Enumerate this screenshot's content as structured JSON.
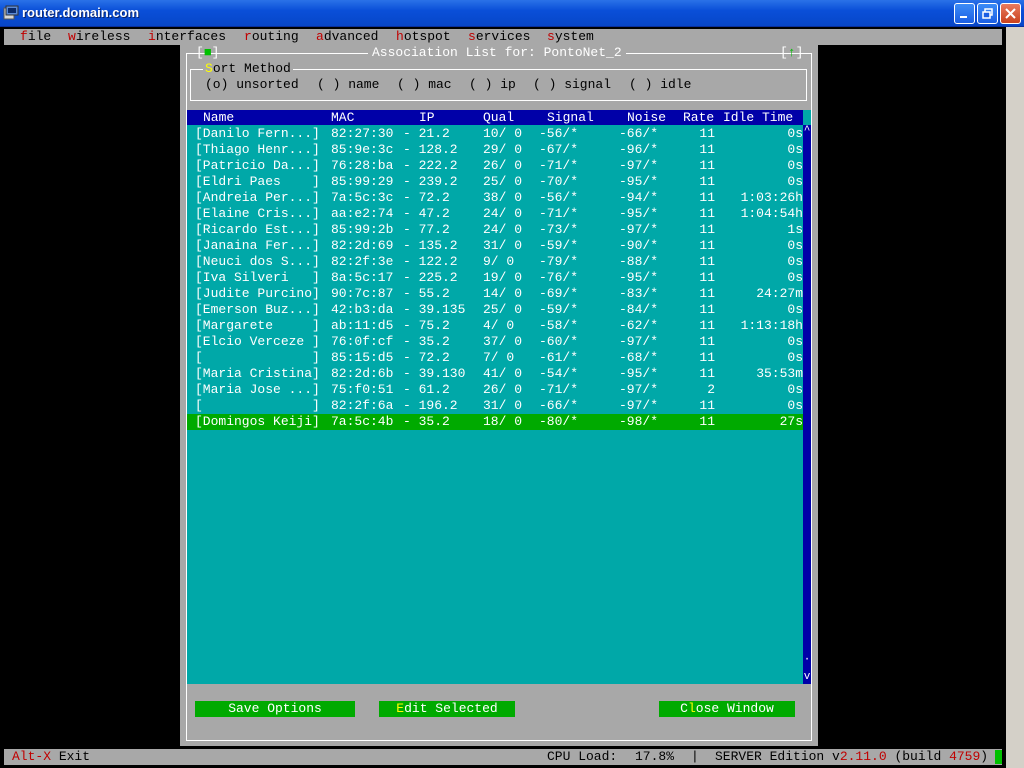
{
  "window": {
    "title": "router.domain.com"
  },
  "menu": [
    {
      "hot": "f",
      "rest": "ile"
    },
    {
      "hot": "w",
      "rest": "ireless"
    },
    {
      "hot": "i",
      "rest": "nterfaces"
    },
    {
      "hot": "r",
      "rest": "outing"
    },
    {
      "hot": "a",
      "rest": "dvanced"
    },
    {
      "hot": "h",
      "rest": "otspot"
    },
    {
      "hot": "s",
      "rest": "ervices"
    },
    {
      "hot": "s",
      "rest": "ystem"
    }
  ],
  "dialog": {
    "title": "Association List for: PontoNet_2",
    "left_corner": "[",
    "left_corner_mark": "■",
    "left_corner_end": "]",
    "right_corner": "[",
    "right_corner_mark": "↑",
    "right_corner_end": "]"
  },
  "sort": {
    "legend_hot": "S",
    "legend_rest": "ort Method",
    "options": [
      "(o) unsorted",
      "( ) name",
      "( ) mac",
      "( ) ip",
      "( ) signal",
      "( ) idle"
    ]
  },
  "columns": {
    "name": "Name",
    "mac": "MAC",
    "ip": "IP",
    "qual": "Qual",
    "signal": "Signal",
    "noise": "Noise",
    "rate": "Rate",
    "idle": "Idle Time"
  },
  "rows": [
    {
      "name": "[Danilo Fern...]",
      "mac": "82:27:30",
      "ip": "- 21.2",
      "qual": "10/ 0",
      "signal": "-56/*",
      "noise": "-66/*",
      "rate": "11",
      "idle": "0s"
    },
    {
      "name": "[Thiago Henr...]",
      "mac": "85:9e:3c",
      "ip": "- 128.2",
      "qual": "29/ 0",
      "signal": "-67/*",
      "noise": "-96/*",
      "rate": "11",
      "idle": "0s"
    },
    {
      "name": "[Patricio Da...]",
      "mac": "76:28:ba",
      "ip": "- 222.2",
      "qual": "26/ 0",
      "signal": "-71/*",
      "noise": "-97/*",
      "rate": "11",
      "idle": "0s"
    },
    {
      "name": "[Eldri Paes    ]",
      "mac": "85:99:29",
      "ip": "- 239.2",
      "qual": "25/ 0",
      "signal": "-70/*",
      "noise": "-95/*",
      "rate": "11",
      "idle": "0s"
    },
    {
      "name": "[Andreia Per...]",
      "mac": "7a:5c:3c",
      "ip": "- 72.2",
      "qual": "38/ 0",
      "signal": "-56/*",
      "noise": "-94/*",
      "rate": "11",
      "idle": "1:03:26h"
    },
    {
      "name": "[Elaine Cris...]",
      "mac": "aa:e2:74",
      "ip": "- 47.2",
      "qual": "24/ 0",
      "signal": "-71/*",
      "noise": "-95/*",
      "rate": "11",
      "idle": "1:04:54h"
    },
    {
      "name": "[Ricardo Est...]",
      "mac": "85:99:2b",
      "ip": "- 77.2",
      "qual": "24/ 0",
      "signal": "-73/*",
      "noise": "-97/*",
      "rate": "11",
      "idle": "1s"
    },
    {
      "name": "[Janaina Fer...]",
      "mac": "82:2d:69",
      "ip": "- 135.2",
      "qual": "31/ 0",
      "signal": "-59/*",
      "noise": "-90/*",
      "rate": "11",
      "idle": "0s"
    },
    {
      "name": "[Neuci dos S...]",
      "mac": "82:2f:3e",
      "ip": "- 122.2",
      "qual": "9/ 0",
      "signal": "-79/*",
      "noise": "-88/*",
      "rate": "11",
      "idle": "0s"
    },
    {
      "name": "[Iva Silveri   ]",
      "mac": "8a:5c:17",
      "ip": "- 225.2",
      "qual": "19/ 0",
      "signal": "-76/*",
      "noise": "-95/*",
      "rate": "11",
      "idle": "0s"
    },
    {
      "name": "[Judite Purcino]",
      "mac": "90:7c:87",
      "ip": "- 55.2",
      "qual": "14/ 0",
      "signal": "-69/*",
      "noise": "-83/*",
      "rate": "11",
      "idle": "24:27m"
    },
    {
      "name": "[Emerson Buz...]",
      "mac": "42:b3:da",
      "ip": "- 39.135",
      "qual": "25/ 0",
      "signal": "-59/*",
      "noise": "-84/*",
      "rate": "11",
      "idle": "0s"
    },
    {
      "name": "[Margarete     ]",
      "mac": "ab:11:d5",
      "ip": "- 75.2",
      "qual": "4/ 0",
      "signal": "-58/*",
      "noise": "-62/*",
      "rate": "11",
      "idle": "1:13:18h"
    },
    {
      "name": "[Elcio Verceze ]",
      "mac": "76:0f:cf",
      "ip": "- 35.2",
      "qual": "37/ 0",
      "signal": "-60/*",
      "noise": "-97/*",
      "rate": "11",
      "idle": "0s"
    },
    {
      "name": "[              ]",
      "mac": "85:15:d5",
      "ip": "- 72.2",
      "qual": "7/ 0",
      "signal": "-61/*",
      "noise": "-68/*",
      "rate": "11",
      "idle": "0s"
    },
    {
      "name": "[Maria Cristina]",
      "mac": "82:2d:6b",
      "ip": "- 39.130",
      "qual": "41/ 0",
      "signal": "-54/*",
      "noise": "-95/*",
      "rate": "11",
      "idle": "35:53m"
    },
    {
      "name": "[Maria Jose ...]",
      "mac": "75:f0:51",
      "ip": "- 61.2",
      "qual": "26/ 0",
      "signal": "-71/*",
      "noise": "-97/*",
      "rate": "2",
      "idle": "0s"
    },
    {
      "name": "[              ]",
      "mac": "82:2f:6a",
      "ip": "- 196.2",
      "qual": "31/ 0",
      "signal": "-66/*",
      "noise": "-97/*",
      "rate": "11",
      "idle": "0s"
    },
    {
      "name": "[Domingos Keiji]",
      "mac": "7a:5c:4b",
      "ip": "- 35.2",
      "qual": "18/ 0",
      "signal": "-80/*",
      "noise": "-98/*",
      "rate": "11",
      "idle": "27s"
    }
  ],
  "selected_row": 18,
  "scrollbar": {
    "up": "^",
    "thumb": "·",
    "down": "v"
  },
  "buttons": {
    "save": {
      "hot": "",
      "rest": "Save Options"
    },
    "edit": {
      "hot": "E",
      "rest": "dit Selected"
    },
    "close": {
      "pre": "C",
      "hot": "l",
      "rest": "ose Window"
    }
  },
  "status": {
    "exit_key": "Alt-X",
    "exit_label": " Exit",
    "cpu_label": "CPU Load:",
    "cpu_value": "17.8%",
    "separator": "|",
    "edition_pre": "SERVER Edition v",
    "edition_version": "2.11.0",
    "build_pre": " (build ",
    "build_num": "4759",
    "build_post": ")"
  },
  "colors": {
    "list_bg": "#00a8a8",
    "header_bg": "#0000a8",
    "selected_bg": "#00aa00",
    "dialog_bg": "#a8a8a8",
    "hotkey": "#c00000",
    "accent_yellow": "#ffff00"
  }
}
